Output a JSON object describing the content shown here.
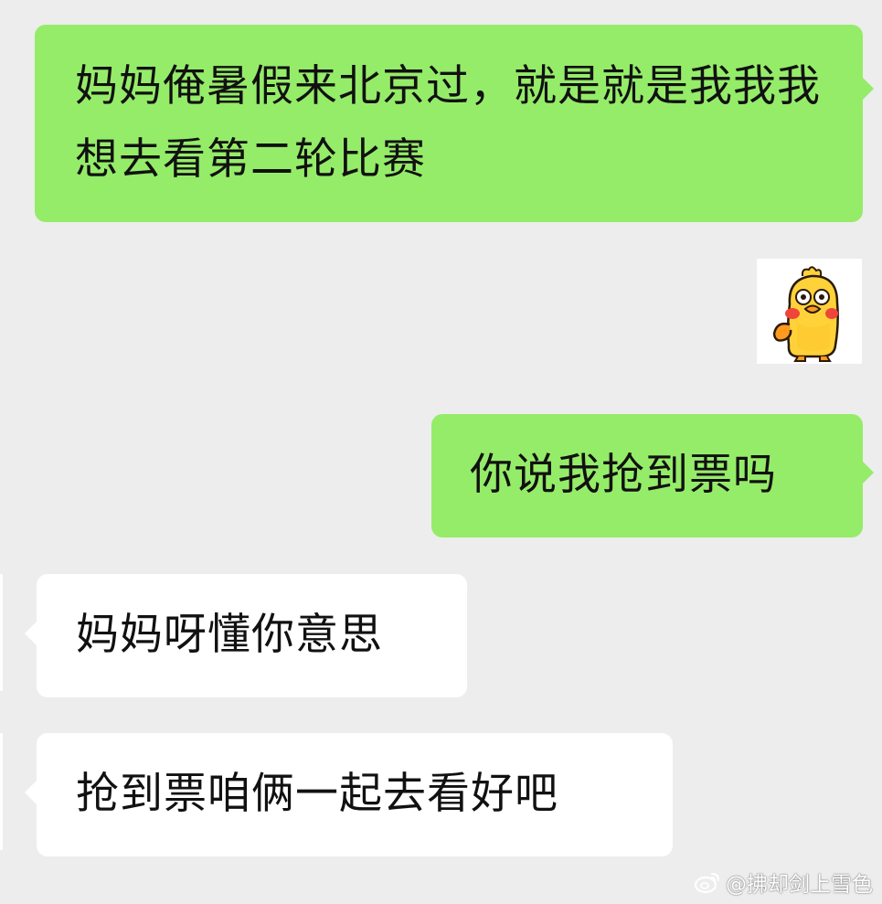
{
  "messages": [
    {
      "side": "sent",
      "text": "妈妈俺暑假来北京过，就是就是我我我想去看第二轮比赛"
    },
    {
      "side": "sent",
      "type": "sticker",
      "sticker_name": "yellow-duck-sticker"
    },
    {
      "side": "sent",
      "text": "你说我抢到票吗"
    },
    {
      "side": "received",
      "text": "妈妈呀懂你意思"
    },
    {
      "side": "received",
      "text": "抢到票咱俩一起去看好吧"
    }
  ],
  "watermark": {
    "text": "@拂却剑上雪色",
    "icon": "weibo-icon"
  },
  "colors": {
    "background": "#ededed",
    "sent_bubble": "#95ec69",
    "received_bubble": "#ffffff"
  }
}
